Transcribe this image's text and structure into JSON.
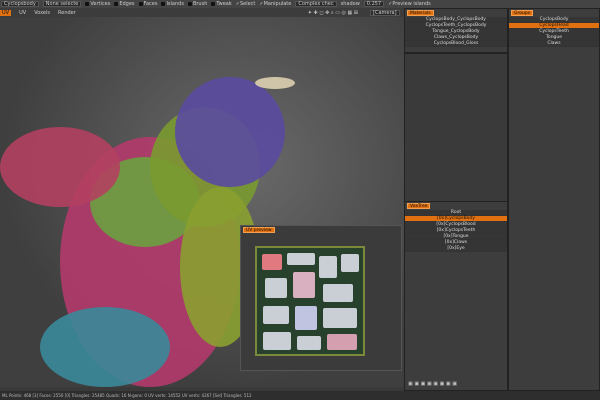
{
  "toolbar": {
    "object": "Cyclopsbody",
    "selection": "None selecte",
    "options": [
      "Vertices",
      "Edges",
      "Faces",
      "Islands",
      "Brush",
      "Tweak"
    ],
    "checks": [
      "Select",
      "Manipulate"
    ],
    "mode": "Complex chec",
    "shadow": "shadow",
    "value": "0.257",
    "preview": "Preview islands"
  },
  "menu": {
    "items": [
      "UV",
      "UV",
      "Voxels",
      "Render"
    ],
    "camera": "[Camera]"
  },
  "materials": {
    "title": "Materials",
    "items": [
      "CyclopsBody_CyclopsBody",
      "CyclopsTeeth_CyclopsBody",
      "Tongue_CyclopsBody",
      "Claws_CyclopsBody",
      "CyclopsBlood_Gloss"
    ]
  },
  "groups": {
    "title": "Groups",
    "items": [
      "CyclopsBody",
      "CyclopsHead",
      "CyclopsTeeth",
      "Tongue",
      "Claws"
    ],
    "selected": 1
  },
  "voxtree": {
    "title": "VoxTree",
    "root": "Root",
    "items": [
      "[0x]CyclopsBody",
      "[0x]CyclopsBlood",
      "[0x]CyclopsTeeth",
      "[0x]Tongue",
      "[0x]Claws",
      "[0x]Eye"
    ],
    "selected": 0
  },
  "uv_preview": {
    "title": "UV preview"
  },
  "status": "ML Points: 468 [3] Faces: 2550 [0] Triangles: 25485 Quads: 16 N-gons: 0 UV verts: 14552 UV verts: 4267 [Sel] Triangles: 512",
  "colors": {
    "accent": "#e07010"
  }
}
